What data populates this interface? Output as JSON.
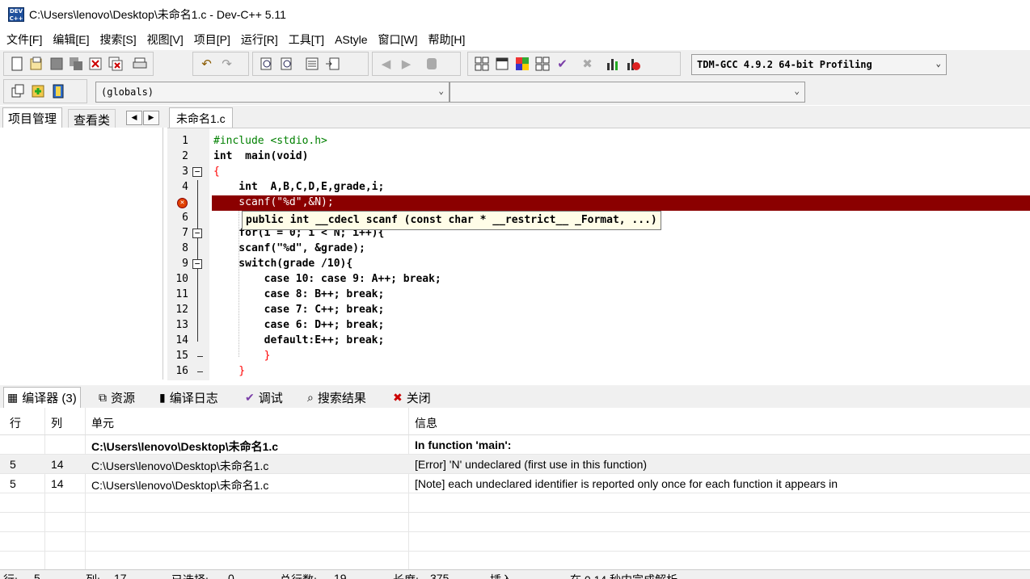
{
  "window": {
    "title": "C:\\Users\\lenovo\\Desktop\\未命名1.c - Dev-C++ 5.11",
    "icon_label": "DEV C++"
  },
  "menu": [
    "文件[F]",
    "编辑[E]",
    "搜索[S]",
    "视图[V]",
    "项目[P]",
    "运行[R]",
    "工具[T]",
    "AStyle",
    "窗口[W]",
    "帮助[H]"
  ],
  "toolbar": {
    "compiler_select": "TDM-GCC 4.9.2 64-bit Profiling",
    "scope_select": "(globals)",
    "symbol_select": ""
  },
  "left_panel": {
    "tabs": [
      "项目管理",
      "查看类"
    ]
  },
  "editor": {
    "tab": "未命名1.c",
    "tooltip": "public int __cdecl scanf (const char * __restrict__ _Format, ...)",
    "error_line": 5,
    "lines": [
      {
        "n": "1",
        "text": "#include <stdio.h>"
      },
      {
        "n": "2",
        "text": "int  main(void)"
      },
      {
        "n": "3",
        "text": "{"
      },
      {
        "n": "4",
        "text": "    int  A,B,C,D,E,grade,i;"
      },
      {
        "n": "5",
        "text": "    scanf(\"%d\",&N);"
      },
      {
        "n": "6",
        "text": ""
      },
      {
        "n": "7",
        "text": "    for(i = 0; i < N; i++){"
      },
      {
        "n": "8",
        "text": "    scanf(\"%d\", &grade);"
      },
      {
        "n": "9",
        "text": "    switch(grade /10){"
      },
      {
        "n": "10",
        "text": "        case 10: case 9: A++; break;"
      },
      {
        "n": "11",
        "text": "        case 8: B++; break;"
      },
      {
        "n": "12",
        "text": "        case 7: C++; break;"
      },
      {
        "n": "13",
        "text": "        case 6: D++; break;"
      },
      {
        "n": "14",
        "text": "        default:E++; break;"
      },
      {
        "n": "15",
        "text": "        }"
      },
      {
        "n": "16",
        "text": "    }"
      }
    ]
  },
  "bottom": {
    "tabs": [
      {
        "label": "编译器 (3)",
        "icon": "grid-icon"
      },
      {
        "label": "资源",
        "icon": "resources-icon"
      },
      {
        "label": "编译日志",
        "icon": "chart-icon"
      },
      {
        "label": "调试",
        "icon": "check-icon"
      },
      {
        "label": "搜索结果",
        "icon": "search-icon"
      },
      {
        "label": "关闭",
        "icon": "close-icon"
      }
    ],
    "columns": [
      "行",
      "列",
      "单元",
      "信息"
    ],
    "rows": [
      {
        "line": "",
        "col": "",
        "unit": "C:\\Users\\lenovo\\Desktop\\未命名1.c",
        "msg": "In function 'main':",
        "bold": true
      },
      {
        "line": "5",
        "col": "14",
        "unit": "C:\\Users\\lenovo\\Desktop\\未命名1.c",
        "msg": "[Error] 'N' undeclared (first use in this function)"
      },
      {
        "line": "5",
        "col": "14",
        "unit": "C:\\Users\\lenovo\\Desktop\\未命名1.c",
        "msg": "[Note] each undeclared identifier is reported only once for each function it appears in"
      }
    ]
  },
  "status": {
    "row_label": "行:",
    "row": "5",
    "col_label": "列:",
    "col": "17",
    "sel_label": "已选择:",
    "sel": "0",
    "lines_label": "总行数:",
    "lines": "19",
    "len_label": "长度:",
    "len": "375",
    "mode": "插入",
    "parse": "在 0.14 秒内完成解析"
  }
}
